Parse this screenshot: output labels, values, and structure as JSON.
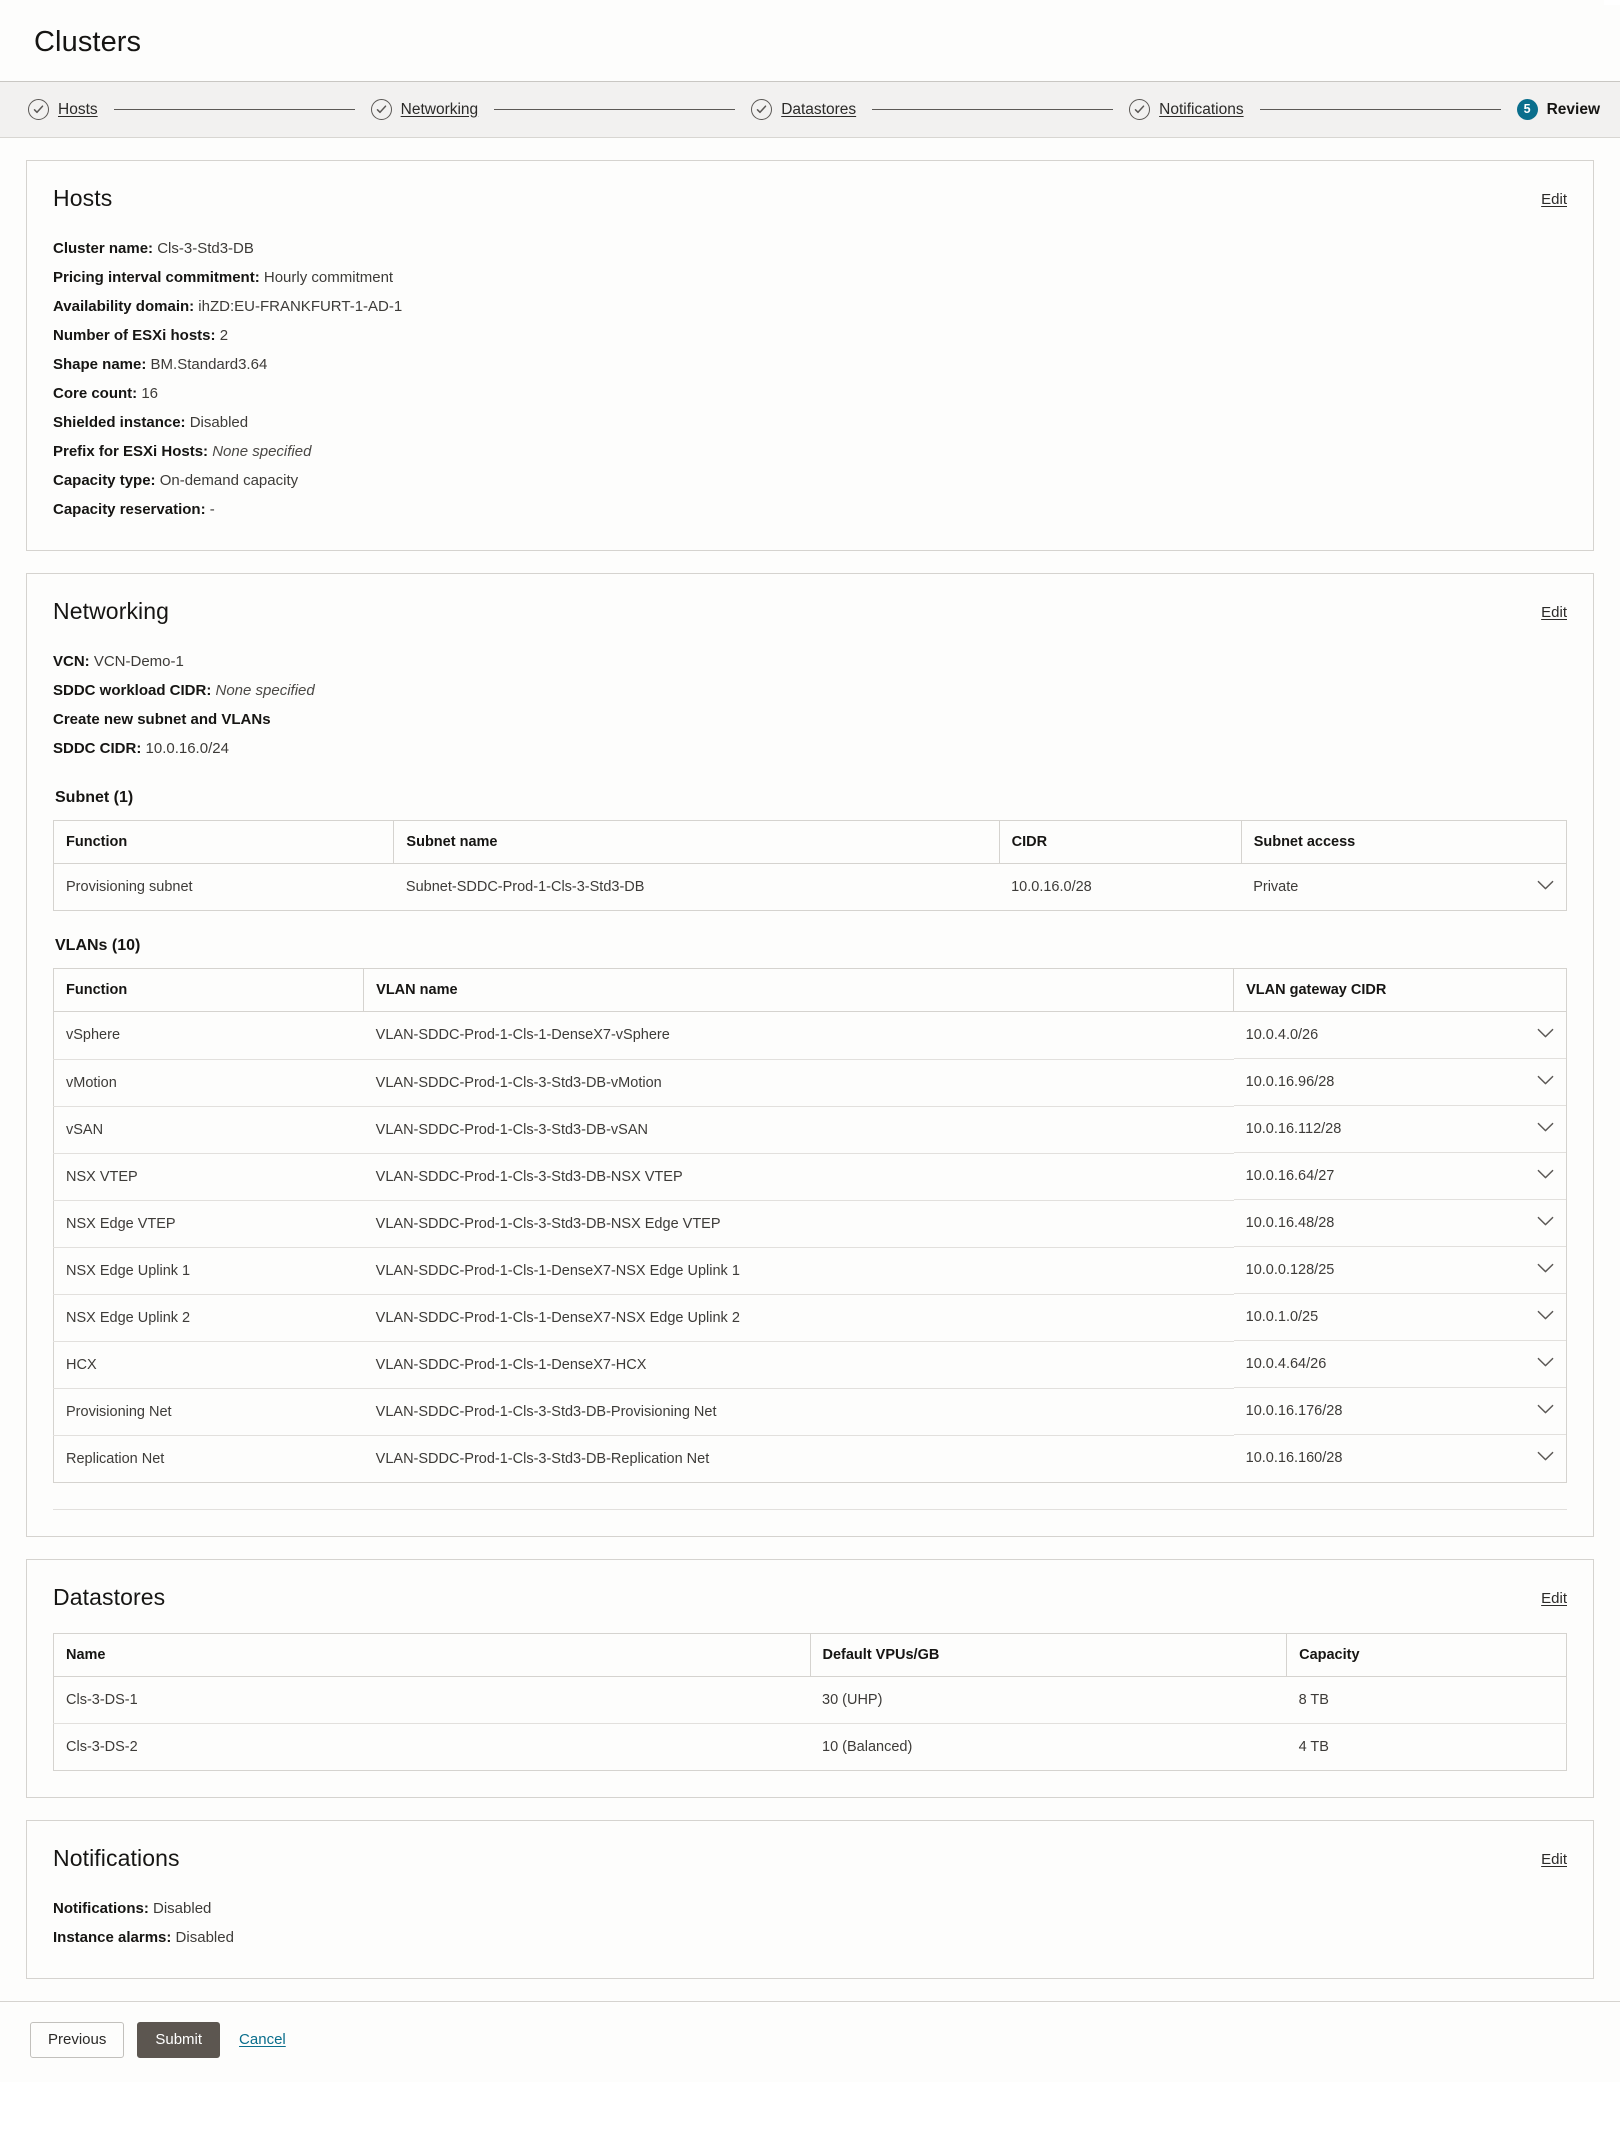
{
  "header": {
    "title": "Clusters"
  },
  "stepper": {
    "steps": [
      {
        "label": "Hosts",
        "state": "done",
        "icon": "check-circle-icon"
      },
      {
        "label": "Networking",
        "state": "done",
        "icon": "check-circle-icon"
      },
      {
        "label": "Datastores",
        "state": "done",
        "icon": "check-circle-icon"
      },
      {
        "label": "Notifications",
        "state": "done",
        "icon": "check-circle-icon"
      },
      {
        "label": "Review",
        "state": "current",
        "number": "5"
      }
    ],
    "current_color": "#0a6e8c"
  },
  "hosts": {
    "title": "Hosts",
    "edit_label": "Edit",
    "fields": [
      {
        "key": "Cluster name:",
        "value": "Cls-3-Std3-DB",
        "italic": false
      },
      {
        "key": "Pricing interval commitment:",
        "value": "Hourly commitment",
        "italic": false
      },
      {
        "key": "Availability domain:",
        "value": "ihZD:EU-FRANKFURT-1-AD-1",
        "italic": false
      },
      {
        "key": "Number of ESXi hosts:",
        "value": "2",
        "italic": false
      },
      {
        "key": "Shape name:",
        "value": "BM.Standard3.64",
        "italic": false
      },
      {
        "key": "Core count:",
        "value": "16",
        "italic": false
      },
      {
        "key": "Shielded instance:",
        "value": "Disabled",
        "italic": false
      },
      {
        "key": "Prefix for ESXi Hosts:",
        "value": "None specified",
        "italic": true
      },
      {
        "key": "Capacity type:",
        "value": "On-demand capacity",
        "italic": false
      },
      {
        "key": "Capacity reservation:",
        "value": "-",
        "italic": false
      }
    ]
  },
  "networking": {
    "title": "Networking",
    "edit_label": "Edit",
    "fields": [
      {
        "key": "VCN:",
        "value": "VCN-Demo-1",
        "italic": false
      },
      {
        "key": "SDDC workload CIDR:",
        "value": "None specified",
        "italic": true
      },
      {
        "key": "Create new subnet and VLANs",
        "value": "",
        "italic": false,
        "standalone": true
      },
      {
        "key": "SDDC CIDR:",
        "value": "10.0.16.0/24",
        "italic": false
      }
    ],
    "subnet": {
      "heading": "Subnet (1)",
      "columns": [
        "Function",
        "Subnet name",
        "CIDR",
        "Subnet access"
      ],
      "rows": [
        {
          "function": "Provisioning subnet",
          "name": "Subnet-SDDC-Prod-1-Cls-3-Std3-DB",
          "cidr": "10.0.16.0/28",
          "access": "Private",
          "expand_icon": "chevron-down-icon"
        }
      ]
    },
    "vlans": {
      "heading": "VLANs (10)",
      "columns": [
        "Function",
        "VLAN name",
        "VLAN gateway CIDR"
      ],
      "rows": [
        {
          "function": "vSphere",
          "name": "VLAN-SDDC-Prod-1-Cls-1-DenseX7-vSphere",
          "cidr": "10.0.4.0/26",
          "expand_icon": "chevron-down-icon"
        },
        {
          "function": "vMotion",
          "name": "VLAN-SDDC-Prod-1-Cls-3-Std3-DB-vMotion",
          "cidr": "10.0.16.96/28",
          "expand_icon": "chevron-down-icon"
        },
        {
          "function": "vSAN",
          "name": "VLAN-SDDC-Prod-1-Cls-3-Std3-DB-vSAN",
          "cidr": "10.0.16.112/28",
          "expand_icon": "chevron-down-icon"
        },
        {
          "function": "NSX VTEP",
          "name": "VLAN-SDDC-Prod-1-Cls-3-Std3-DB-NSX VTEP",
          "cidr": "10.0.16.64/27",
          "expand_icon": "chevron-down-icon"
        },
        {
          "function": "NSX Edge VTEP",
          "name": "VLAN-SDDC-Prod-1-Cls-3-Std3-DB-NSX Edge VTEP",
          "cidr": "10.0.16.48/28",
          "expand_icon": "chevron-down-icon"
        },
        {
          "function": "NSX Edge Uplink 1",
          "name": "VLAN-SDDC-Prod-1-Cls-1-DenseX7-NSX Edge Uplink 1",
          "cidr": "10.0.0.128/25",
          "expand_icon": "chevron-down-icon"
        },
        {
          "function": "NSX Edge Uplink 2",
          "name": "VLAN-SDDC-Prod-1-Cls-1-DenseX7-NSX Edge Uplink 2",
          "cidr": "10.0.1.0/25",
          "expand_icon": "chevron-down-icon"
        },
        {
          "function": "HCX",
          "name": "VLAN-SDDC-Prod-1-Cls-1-DenseX7-HCX",
          "cidr": "10.0.4.64/26",
          "expand_icon": "chevron-down-icon"
        },
        {
          "function": "Provisioning Net",
          "name": "VLAN-SDDC-Prod-1-Cls-3-Std3-DB-Provisioning Net",
          "cidr": "10.0.16.176/28",
          "expand_icon": "chevron-down-icon"
        },
        {
          "function": "Replication Net",
          "name": "VLAN-SDDC-Prod-1-Cls-3-Std3-DB-Replication Net",
          "cidr": "10.0.16.160/28",
          "expand_icon": "chevron-down-icon"
        }
      ]
    }
  },
  "datastores": {
    "title": "Datastores",
    "edit_label": "Edit",
    "columns": [
      "Name",
      "Default VPUs/GB",
      "Capacity"
    ],
    "rows": [
      {
        "name": "Cls-3-DS-1",
        "vpus": "30 (UHP)",
        "capacity": "8 TB"
      },
      {
        "name": "Cls-3-DS-2",
        "vpus": "10 (Balanced)",
        "capacity": "4 TB"
      }
    ]
  },
  "notifications": {
    "title": "Notifications",
    "edit_label": "Edit",
    "fields": [
      {
        "key": "Notifications:",
        "value": "Disabled",
        "italic": false
      },
      {
        "key": "Instance alarms:",
        "value": "Disabled",
        "italic": false
      }
    ]
  },
  "footer": {
    "previous_label": "Previous",
    "submit_label": "Submit",
    "cancel_label": "Cancel"
  }
}
